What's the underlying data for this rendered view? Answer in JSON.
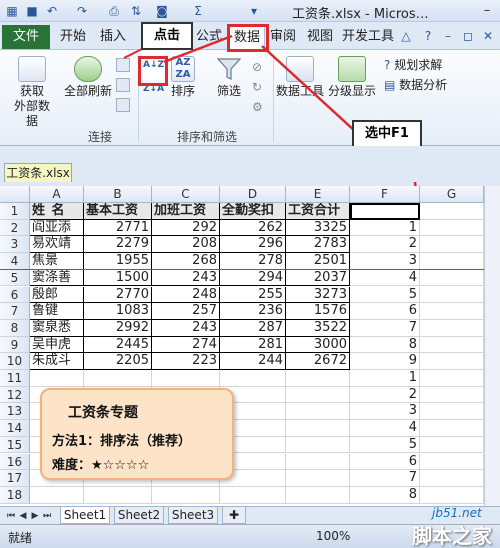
{
  "titlebar": {
    "title": "工资条.xlsx - Micros…",
    "qa_icons": [
      "save-icon",
      "undo-icon",
      "redo-icon",
      "print-preview-icon",
      "sort-icon",
      "sum-icon",
      "more-icon"
    ],
    "min": "–",
    "max": "□",
    "close": "✕"
  },
  "tabs": {
    "file": "文件",
    "items": [
      "开始",
      "插入",
      "公式",
      "数据",
      "审阅",
      "视图",
      "开发工具"
    ]
  },
  "ribbon": {
    "get_external_data": "获取\n外部数据",
    "refresh_all": "全部刷新",
    "connections_group": "连接",
    "sort_btn": "排序",
    "filter_btn": "筛选",
    "sort_filter_group": "排序和筛选",
    "data_tools": "数据工具",
    "outline": "分级显示",
    "solver": "规划求解",
    "data_analysis": "数据分析",
    "sort_az": "A↓Z",
    "sort_za": "Z↓A"
  },
  "annotations": {
    "click_label": "点击",
    "select_label": "选中F1"
  },
  "workbook_tab": "工资条.xlsx",
  "grid": {
    "columns": [
      "A",
      "B",
      "C",
      "D",
      "E",
      "F",
      "G"
    ],
    "rows": [
      "1",
      "2",
      "3",
      "4",
      "5",
      "6",
      "7",
      "8",
      "9",
      "10",
      "11",
      "12",
      "13",
      "14",
      "15",
      "16",
      "17",
      "18"
    ],
    "header_row": [
      "姓 名",
      "基本工资",
      "加班工资",
      "全勤奖扣",
      "工资合计"
    ],
    "data": [
      [
        "阎亚添",
        "2771",
        "292",
        "262",
        "3325",
        "1"
      ],
      [
        "易欢靖",
        "2279",
        "208",
        "296",
        "2783",
        "2"
      ],
      [
        "焦景",
        "1955",
        "268",
        "278",
        "2501",
        "3"
      ],
      [
        "窦涤善",
        "1500",
        "243",
        "294",
        "2037",
        "4"
      ],
      [
        "殷郎",
        "2770",
        "248",
        "255",
        "3273",
        "5"
      ],
      [
        "鲁键",
        "1083",
        "257",
        "236",
        "1576",
        "6"
      ],
      [
        "窦泉悉",
        "2992",
        "243",
        "287",
        "3522",
        "7"
      ],
      [
        "吴申虎",
        "2445",
        "274",
        "281",
        "3000",
        "8"
      ],
      [
        "朱成斗",
        "2205",
        "223",
        "244",
        "2672",
        "9"
      ]
    ],
    "f_extra": [
      "1",
      "2",
      "3",
      "4",
      "5",
      "6",
      "7",
      "8"
    ]
  },
  "card": {
    "title": "工资条专题",
    "method": "方法1：排序法（推荐）",
    "difficulty": "难度：★☆☆☆☆"
  },
  "sheets": [
    "Sheet1",
    "Sheet2",
    "Sheet3"
  ],
  "status": {
    "ready": "就绪",
    "zoom": "100%"
  },
  "watermark": {
    "site": "jb51.net",
    "name": "脚本之家"
  },
  "colors": {
    "file_tab": "#2a7338",
    "annotation": "#e0292c",
    "card_bg": "#fde4c8"
  }
}
